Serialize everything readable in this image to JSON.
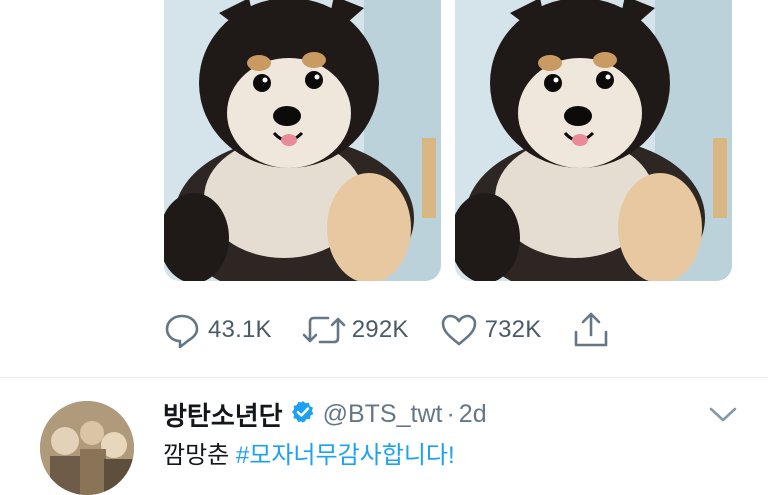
{
  "tweet": {
    "actions": {
      "replies": "43.1K",
      "retweets": "292K",
      "likes": "732K"
    },
    "media": [
      {
        "icon": "pomeranian-photo"
      },
      {
        "icon": "pomeranian-photo"
      }
    ]
  },
  "next_tweet": {
    "display_name": "방탄소년단",
    "handle": "@BTS_twt",
    "separator": "·",
    "time": "2d",
    "text_prefix": "깜망춘 ",
    "hashtag": "#모자너무감사합니다!"
  },
  "colors": {
    "icon_gray": "#657786",
    "link_blue": "#1da1f2",
    "verified_blue": "#1da1f2",
    "divider": "#e6ecf0"
  }
}
